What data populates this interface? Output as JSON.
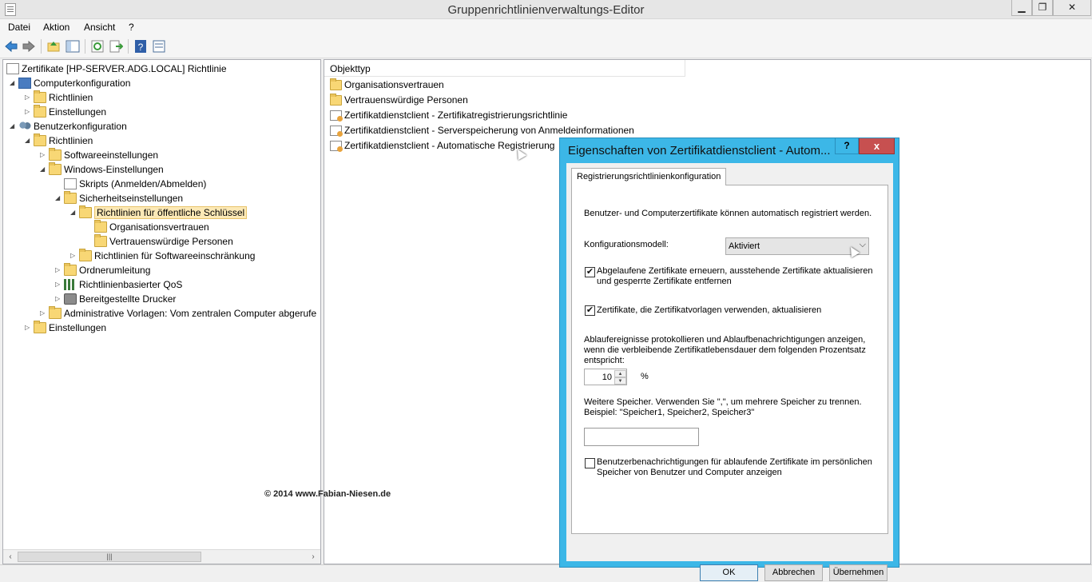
{
  "window": {
    "title": "Gruppenrichtlinienverwaltungs-Editor",
    "min_glyph": "▁",
    "max_glyph": "❐",
    "close_glyph": "✕"
  },
  "menu": {
    "items": [
      "Datei",
      "Aktion",
      "Ansicht",
      "?"
    ]
  },
  "toolbar": {
    "icons": [
      "back-arrow-icon",
      "forward-arrow-icon",
      "up-folder-icon",
      "show-hide-tree-icon",
      "refresh-icon",
      "export-list-icon",
      "help-icon",
      "properties-icon"
    ]
  },
  "tree": {
    "root": "Zertifikate [HP-SERVER.ADG.LOCAL] Richtlinie",
    "computer_config": "Computerkonfiguration",
    "richtlinien_1": "Richtlinien",
    "einstellungen_1": "Einstellungen",
    "user_config": "Benutzerkonfiguration",
    "richtlinien_2": "Richtlinien",
    "software_settings": "Softwareeinstellungen",
    "windows_settings": "Windows-Einstellungen",
    "scripts": "Skripts (Anmelden/Abmelden)",
    "security_settings": "Sicherheitseinstellungen",
    "public_key_policies": "Richtlinien für öffentliche Schlüssel",
    "org_trust": "Organisationsvertrauen",
    "trusted_people": "Vertrauenswürdige Personen",
    "software_restriction": "Richtlinien für Softwareeinschränkung",
    "folder_redirection": "Ordnerumleitung",
    "qos": "Richtlinienbasierter QoS",
    "printers": "Bereitgestellte Drucker",
    "admin_templates": "Administrative Vorlagen: Vom zentralen Computer abgerufe",
    "einstellungen_2": "Einstellungen"
  },
  "tree_scroll": {
    "left": "‹",
    "right": "›",
    "thumb_grip": "|||"
  },
  "list": {
    "column": "Objekttyp",
    "rows": [
      "Organisationsvertrauen",
      "Vertrauenswürdige Personen",
      "Zertifikatdienstclient - Zertifikatregistrierungsrichtlinie",
      "Zertifikatdienstclient - Serverspeicherung von Anmeldeinformationen",
      "Zertifikatdienstclient - Automatische Registrierung"
    ]
  },
  "dialog": {
    "title": "Eigenschaften von Zertifikatdienstclient - Autom...",
    "help": "?",
    "close": "x",
    "tab": "Registrierungsrichtlinienkonfiguration",
    "intro": "Benutzer- und Computerzertifikate können automatisch registriert werden.",
    "model_label": "Konfigurationsmodell:",
    "model_value": "Aktiviert",
    "model_arrow": "⌵",
    "cb1_line1": "Abgelaufene Zertifikate erneuern, ausstehende Zertifikate aktualisieren",
    "cb1_line2": "und gesperrte Zertifikate entfernen",
    "cb1_checked": true,
    "cb2": "Zertifikate, die Zertifikatvorlagen verwenden, aktualisieren",
    "cb2_checked": true,
    "expiry_line1": "Ablaufereignisse protokollieren und Ablaufbenachrichtigungen anzeigen,",
    "expiry_line2": "wenn die verbleibende Zertifikatlebensdauer dem folgenden Prozentsatz",
    "expiry_line3": "entspricht:",
    "percent_value": "10",
    "percent_unit": "%",
    "stores_line1": "Weitere Speicher. Verwenden Sie \",\", um mehrere Speicher zu trennen.",
    "stores_line2": "Beispiel: \"Speicher1, Speicher2, Speicher3\"",
    "stores_value": "",
    "cb3_line1": "Benutzerbenachrichtigungen für ablaufende Zertifikate im persönlichen",
    "cb3_line2": "Speicher von Benutzer und Computer anzeigen",
    "cb3_checked": false,
    "check_glyph": "✔",
    "spin_up": "▲",
    "spin_down": "▼",
    "copyright": "© 2014 www.Fabian-Niesen.de",
    "ok": "OK",
    "cancel": "Abbrechen",
    "apply": "Übernehmen"
  }
}
